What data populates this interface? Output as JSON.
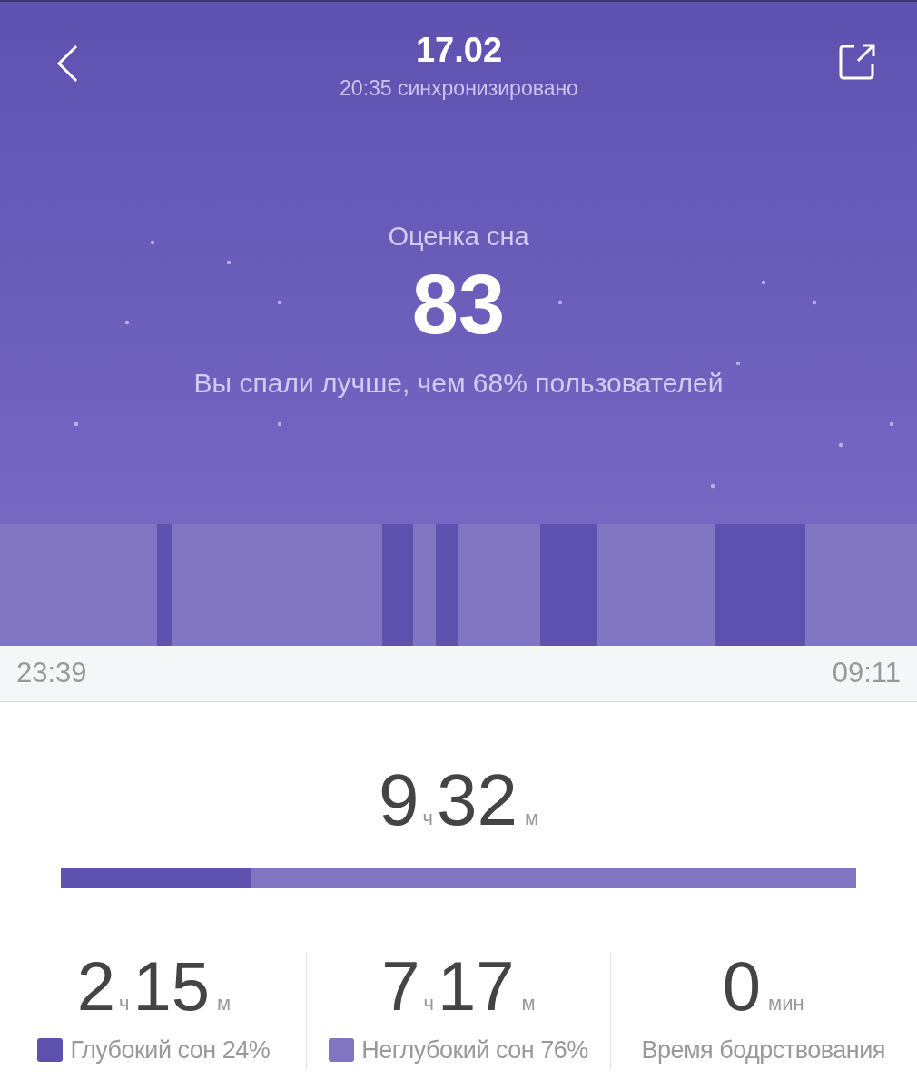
{
  "header": {
    "title": "17.02",
    "subtitle": "20:35 синхронизировано"
  },
  "score": {
    "label": "Оценка сна",
    "value": "83",
    "comparison": "Вы спали лучше, чем 68% пользователей"
  },
  "timeline": {
    "start": "23:39",
    "end": "09:11"
  },
  "total": {
    "hours": "9",
    "hours_unit": "ч",
    "minutes": "32",
    "minutes_unit": "м",
    "level": 0.24
  },
  "stats": [
    {
      "kind": "hm",
      "hours": "2",
      "hours_unit": "ч",
      "minutes": "15",
      "minutes_unit": "м",
      "label": "Глубокий сон 24%",
      "color": "#5f51b0"
    },
    {
      "kind": "hm",
      "hours": "7",
      "hours_unit": "ч",
      "minutes": "17",
      "minutes_unit": "м",
      "label": "Неглубокий сон 76%",
      "color": "#8175c1"
    },
    {
      "kind": "min",
      "minutes": "0",
      "minutes_unit": "мин",
      "label": "Время бодрствования"
    }
  ]
}
